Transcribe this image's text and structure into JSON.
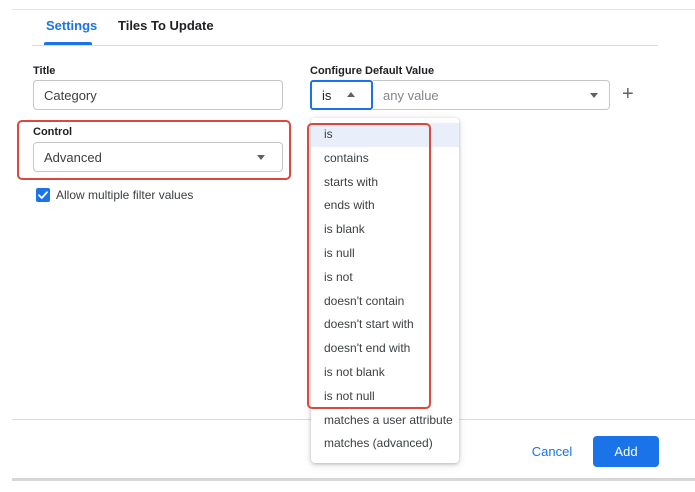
{
  "tabs": [
    {
      "label": "Settings",
      "active": true
    },
    {
      "label": "Tiles To Update",
      "active": false
    }
  ],
  "title_field": {
    "label": "Title",
    "value": "Category"
  },
  "default_value": {
    "label": "Configure Default Value",
    "operator": "is",
    "value_placeholder": "any value",
    "add_icon": "plus-icon"
  },
  "control": {
    "label": "Control",
    "value": "Advanced"
  },
  "allow_multiple": {
    "label": "Allow multiple filter values",
    "checked": true
  },
  "operator_menu": {
    "selected": "is",
    "items": [
      "is",
      "contains",
      "starts with",
      "ends with",
      "is blank",
      "is null",
      "is not",
      "doesn't contain",
      "doesn't start with",
      "doesn't end with",
      "is not blank",
      "is not null",
      "matches a user attribute",
      "matches (advanced)"
    ]
  },
  "buttons": {
    "cancel": "Cancel",
    "add": "Add"
  },
  "colors": {
    "accent": "#1a73e8",
    "highlight": "#d9493d",
    "selected_bg": "#e8eefa"
  }
}
